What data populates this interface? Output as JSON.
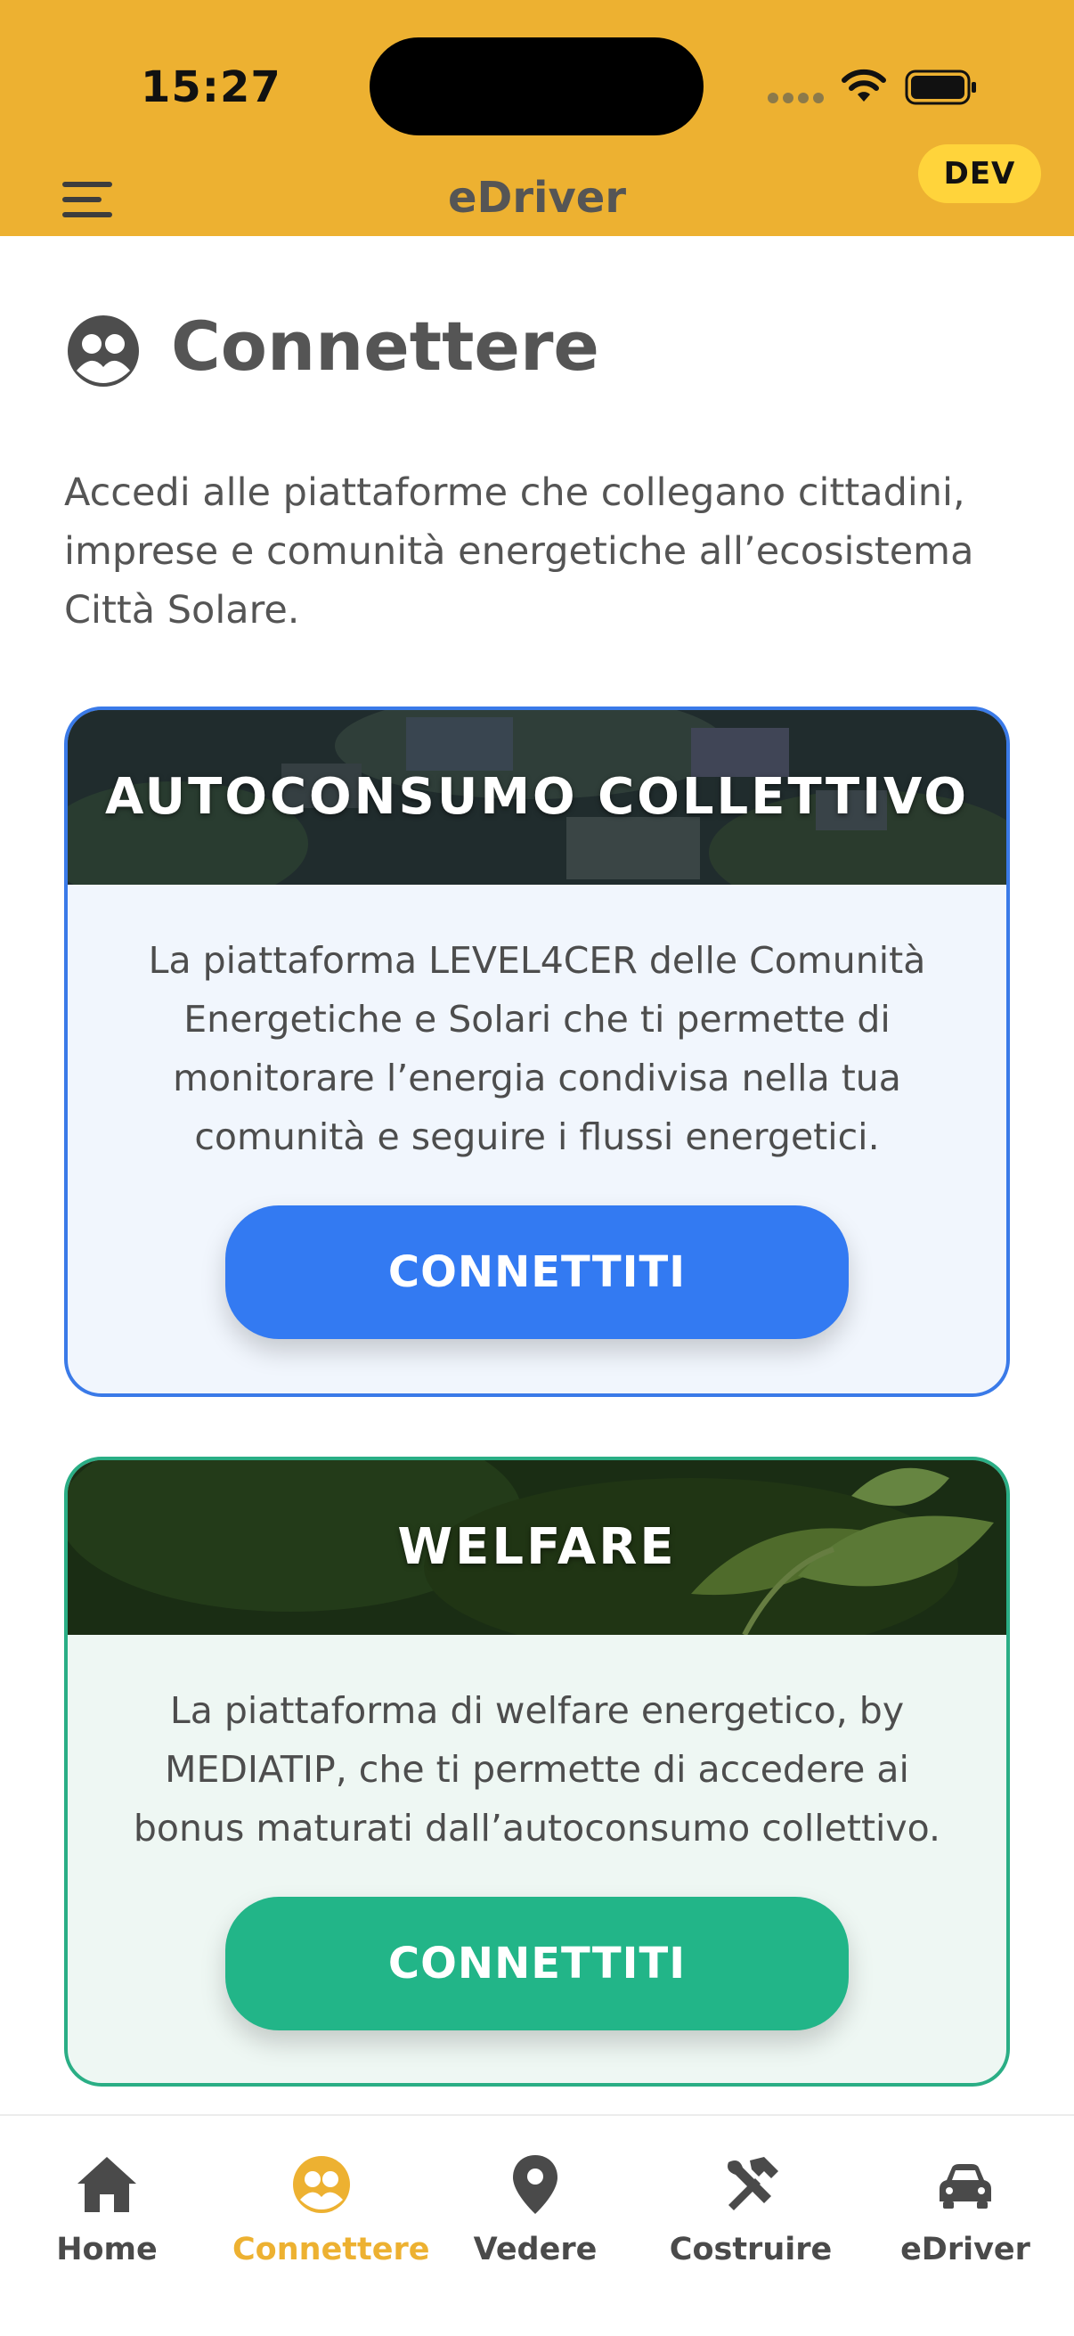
{
  "status_bar": {
    "time": "15:27"
  },
  "app_bar": {
    "title": "eDriver",
    "env_badge": "DEV"
  },
  "page": {
    "title": "Connettere",
    "intro": "Accedi alle piattaforme che collegano cittadini, imprese e comunità energetiche all’ecosistema Città Solare."
  },
  "cards": [
    {
      "title": "AUTOCONSUMO COLLETTIVO",
      "description": "La piattaforma LEVEL4CER delle Comunità Energetiche e Solari che ti permette di monitorare l’energia condivisa nella tua comunità e seguire i flussi energetici.",
      "button_label": "CONNETTITI",
      "accent_color": "#337af2"
    },
    {
      "title": "WELFARE",
      "description": "La piattaforma di welfare energetico, by MEDIATIP, che ti permette di accedere ai bonus maturati dall’autoconsumo collettivo.",
      "button_label": "CONNETTITI",
      "accent_color": "#22b588"
    }
  ],
  "tab_bar": {
    "active": "Connettere",
    "active_color": "#edb131",
    "items": [
      {
        "label": "Home",
        "icon": "home-icon"
      },
      {
        "label": "Connettere",
        "icon": "people-icon"
      },
      {
        "label": "Vedere",
        "icon": "map-pin-icon"
      },
      {
        "label": "Costruire",
        "icon": "tools-icon"
      },
      {
        "label": "eDriver",
        "icon": "car-icon"
      }
    ]
  }
}
